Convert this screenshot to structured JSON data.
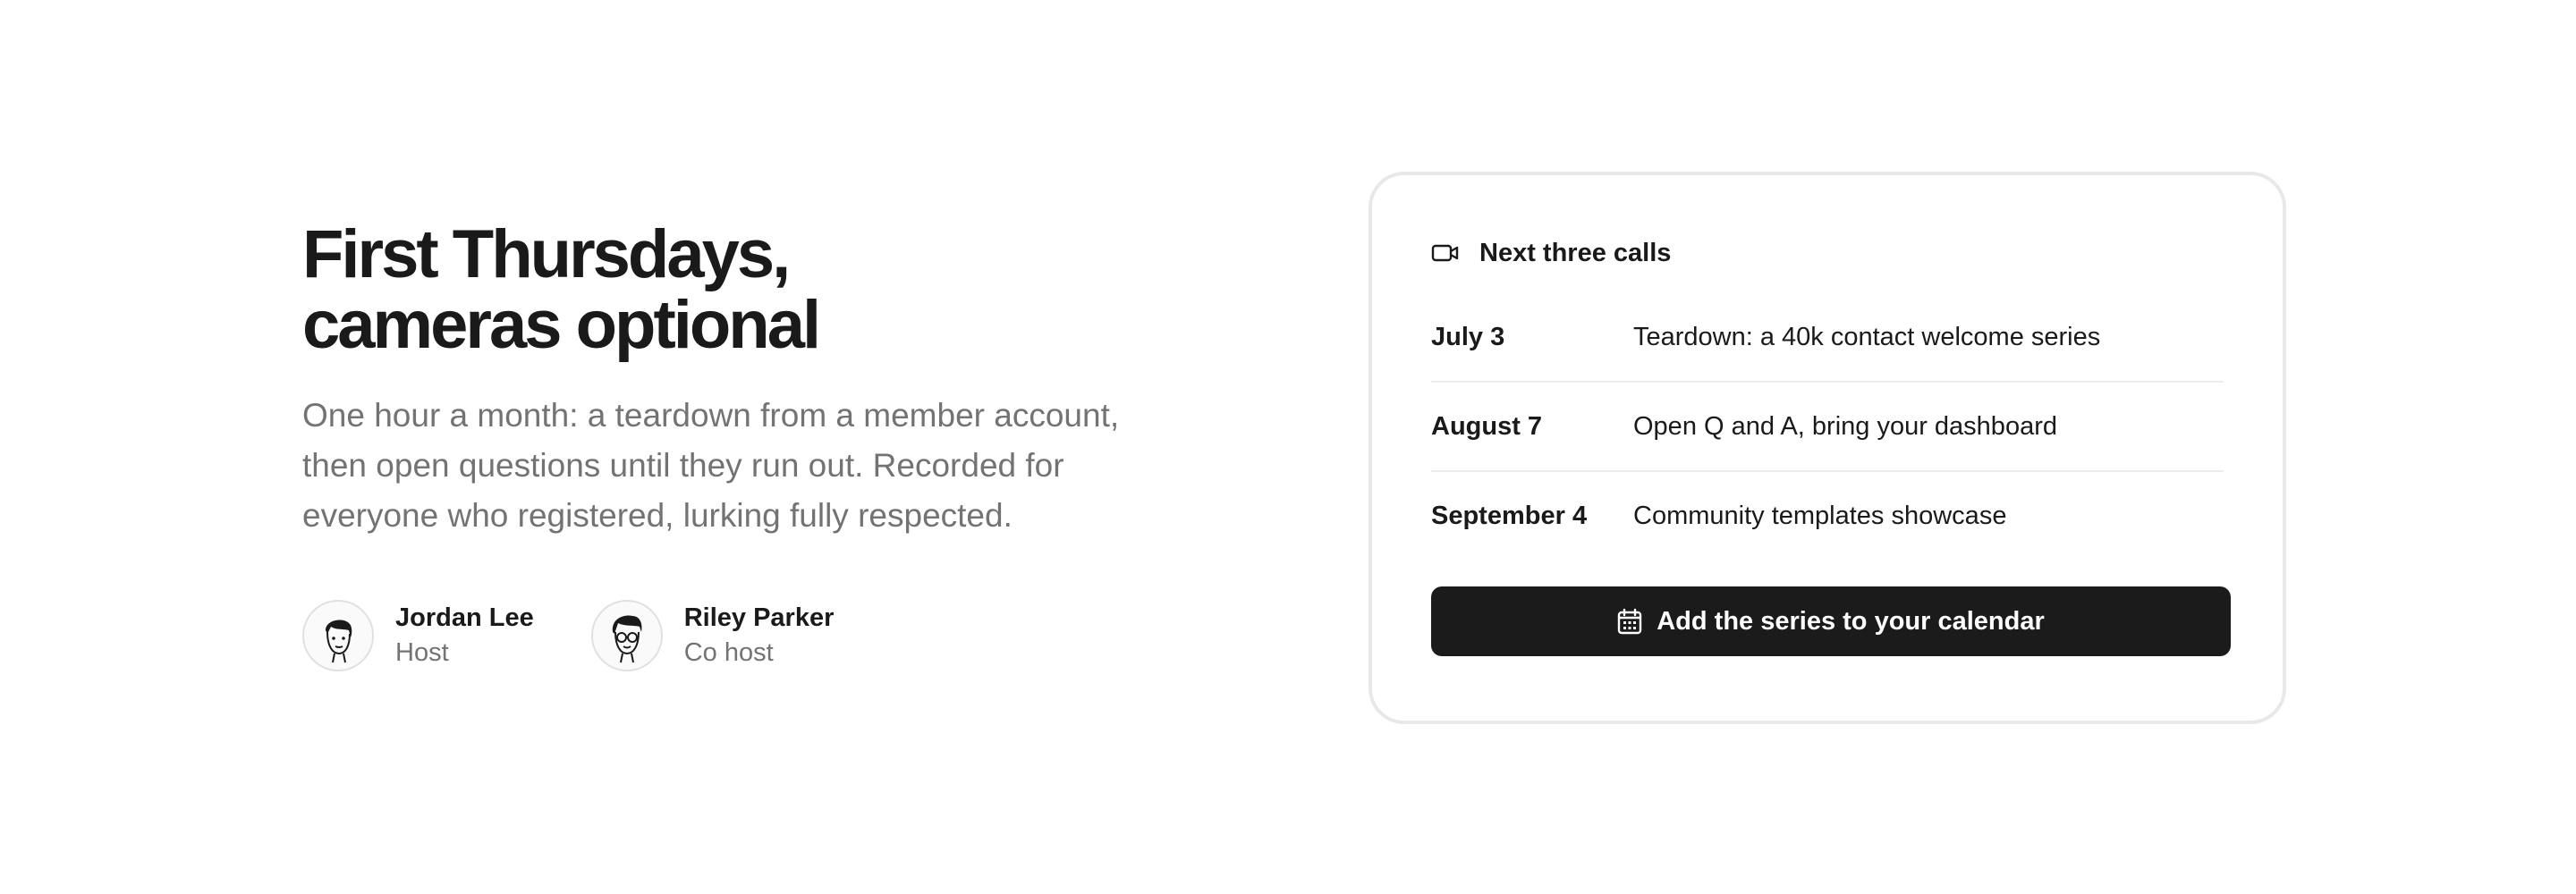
{
  "headline": {
    "line1": "First Thursdays,",
    "line2": "cameras optional"
  },
  "description": "One hour a month: a teardown from a member account, then open questions until they run out. Recorded for everyone who registered, lurking fully respected.",
  "hosts": [
    {
      "name": "Jordan Lee",
      "role": "Host",
      "icon": "avatar-icon"
    },
    {
      "name": "Riley Parker",
      "role": "Co host",
      "icon": "avatar-icon"
    }
  ],
  "card": {
    "title": "Next three calls",
    "icon": "video-camera-icon",
    "calls": [
      {
        "date": "July 3",
        "topic": "Teardown: a 40k contact welcome series"
      },
      {
        "date": "August 7",
        "topic": "Open Q and A, bring your dashboard"
      },
      {
        "date": "September 4",
        "topic": "Community templates showcase"
      }
    ],
    "cta": {
      "label": "Add the series to your calendar",
      "icon": "calendar-icon"
    }
  },
  "colors": {
    "text": "#1a1a1a",
    "muted": "#737373",
    "button": "#1b1b1b",
    "border": "#e8e8e8"
  }
}
